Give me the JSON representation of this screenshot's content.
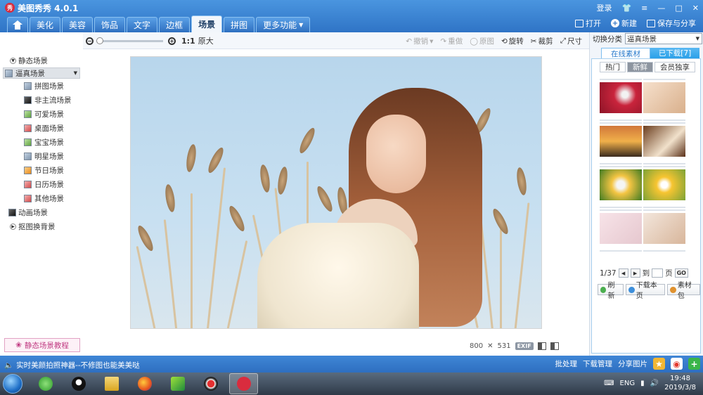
{
  "app": {
    "title": "美图秀秀 4.0.1",
    "logo_text": "秀"
  },
  "window": {
    "login": "登录",
    "skin_icon": "shirt-icon",
    "menu_icon": "menu-icon",
    "minimize": "—",
    "restore": "□",
    "close": "✕"
  },
  "nav_tabs": [
    {
      "label": "美化"
    },
    {
      "label": "美容"
    },
    {
      "label": "饰品"
    },
    {
      "label": "文字"
    },
    {
      "label": "边框"
    },
    {
      "label": "场景",
      "active": true
    },
    {
      "label": "拼图"
    },
    {
      "label": "更多功能"
    }
  ],
  "top_actions": {
    "open": "打开",
    "new": "新建",
    "save_share": "保存与分享"
  },
  "toolbar": {
    "ratio": "1:1",
    "original": "原大",
    "undo": "撤销",
    "redo": "重做",
    "original_image": "原图",
    "rotate": "旋转",
    "crop": "裁剪",
    "size": "尺寸"
  },
  "sidebar": {
    "static": "静态场景",
    "items": [
      "逼真场景",
      "拼图场景",
      "非主流场景",
      "可爱场景",
      "桌面场景",
      "宝宝场景",
      "明星场景",
      "节日场景",
      "日历场景",
      "其他场景"
    ],
    "animated": "动画场景",
    "cutout": "抠图换背景",
    "tutorial": "静态场景教程"
  },
  "image_info": {
    "width": "800",
    "times": "✕",
    "height": "531",
    "exif": "EXIF"
  },
  "right_panel": {
    "switch_label": "切换分类",
    "category": "逼真场景",
    "tab_online": "在线素材",
    "tab_downloaded": "已下载[7]",
    "sub_hot": "热门",
    "sub_new": "新鲜",
    "sub_vip": "会员独享",
    "page": "1/37",
    "goto": "到",
    "page_unit": "页",
    "go": "GO",
    "refresh": "刷新",
    "download_page": "下载本页",
    "material_pack": "素材包"
  },
  "statusbar": {
    "promo": "实时美颜拍照神器--不修图也能美美哒",
    "batch": "批处理",
    "download_mgr": "下载管理",
    "share": "分享图片"
  },
  "taskbar": {
    "time": "19:48",
    "date": "2019/3/8",
    "tray_text": "ENG"
  },
  "colors": {
    "accent": "#2f74c6",
    "tutorial": "#c03a82",
    "panel_tab": "#2aa0e8"
  }
}
